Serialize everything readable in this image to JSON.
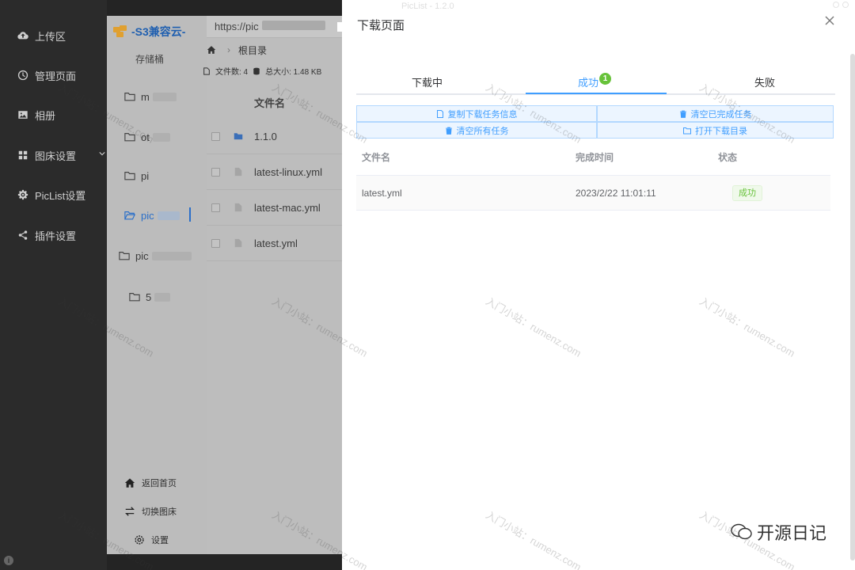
{
  "window": {
    "title": "PicList - 1.2.0"
  },
  "nav": {
    "items": [
      {
        "label": "上传区",
        "icon": "cloud-upload-icon"
      },
      {
        "label": "管理页面",
        "icon": "clock-icon"
      },
      {
        "label": "相册",
        "icon": "image-icon"
      },
      {
        "label": "图床设置",
        "icon": "grid-icon"
      },
      {
        "label": "PicList设置",
        "icon": "gear-icon"
      },
      {
        "label": "插件设置",
        "icon": "share-icon"
      }
    ]
  },
  "bucket": {
    "logo_text": "-S3兼容云-",
    "subtitle": "存储桶",
    "folders": [
      {
        "label": "m"
      },
      {
        "label": "ot"
      },
      {
        "label": "pi"
      },
      {
        "label": "pic"
      },
      {
        "label": "pic"
      },
      {
        "label": "5"
      }
    ],
    "bottom": [
      {
        "label": "返回首页",
        "icon": "home-icon"
      },
      {
        "label": "切换图床",
        "icon": "switch-icon"
      },
      {
        "label": "设置",
        "icon": "gear-icon"
      }
    ]
  },
  "files": {
    "url": "https://pic",
    "breadcrumb_root": "根目录",
    "file_count": "文件数: 4",
    "total_size": "总大小: 1.48 KB",
    "column_name": "文件名",
    "rows": [
      {
        "name": "1.1.0",
        "type": "folder"
      },
      {
        "name": "latest-linux.yml",
        "type": "file"
      },
      {
        "name": "latest-mac.yml",
        "type": "file"
      },
      {
        "name": "latest.yml",
        "type": "file"
      }
    ]
  },
  "drawer": {
    "title": "下载页面",
    "tabs": [
      {
        "label": "下载中"
      },
      {
        "label": "成功",
        "badge": "1"
      },
      {
        "label": "失败"
      }
    ],
    "actions": {
      "copy_info": "复制下载任务信息",
      "clear_done": "清空已完成任务",
      "clear_all": "清空所有任务",
      "open_dir": "打开下载目录"
    },
    "table": {
      "headers": {
        "name": "文件名",
        "time": "完成时间",
        "status": "状态"
      },
      "rows": [
        {
          "name": "latest.yml",
          "time": "2023/2/22 11:01:11",
          "status": "成功"
        }
      ]
    }
  },
  "watermark": "入门小站：rumenz.com",
  "brand": "开源日记",
  "colors": {
    "accent": "#409eff",
    "success": "#67c23a",
    "nav_bg": "#2b2b2b",
    "brand_blue": "#1f5fb0"
  }
}
